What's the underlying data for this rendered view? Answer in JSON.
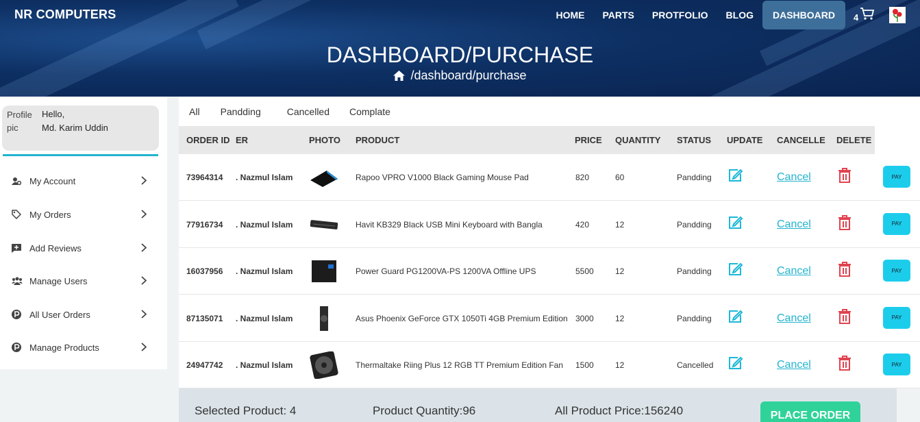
{
  "brand": "NR COMPUTERS",
  "nav": {
    "items": [
      "HOME",
      "PARTS",
      "PROTFOLIO",
      "BLOG",
      "DASHBOARD"
    ],
    "cart_count": "4"
  },
  "hero": {
    "title": "DASHBOARD/PURCHASE",
    "breadcrumb": "/dashboard/purchase"
  },
  "profile": {
    "pic_alt": "Profile pic",
    "greeting": "Hello,",
    "name": "Md. Karim Uddin"
  },
  "sidebar": {
    "items": [
      {
        "label": "My Account",
        "icon": "user-gear-icon"
      },
      {
        "label": "My Orders",
        "icon": "tag-icon"
      },
      {
        "label": "Add Reviews",
        "icon": "review-icon"
      },
      {
        "label": "Manage Users",
        "icon": "users-icon"
      },
      {
        "label": "All User Orders",
        "icon": "p-circle-icon"
      },
      {
        "label": "Manage Products",
        "icon": "p-circle-icon"
      }
    ]
  },
  "filters": [
    "All",
    "Pandding",
    "Cancelled",
    "Complate"
  ],
  "table": {
    "headers": [
      "ORDER ID",
      "ER",
      "PHOTO",
      "PRODUCT",
      "PRICE",
      "QUANTITY",
      "STATUS",
      "UPDATE",
      "CANCELLE",
      "DELETE"
    ],
    "cancel_label": "Cancel",
    "pay_label": "PAY",
    "rows": [
      {
        "order_id": "73964314",
        "customer": ". Nazmul Islam",
        "product": "Rapoo VPRO V1000 Black Gaming Mouse Pad",
        "price": "820",
        "quantity": "60",
        "status": "Pandding",
        "photo": "mousepad"
      },
      {
        "order_id": "77916734",
        "customer": ". Nazmul Islam",
        "product": "Havit KB329 Black USB Mini Keyboard with Bangla",
        "price": "420",
        "quantity": "12",
        "status": "Pandding",
        "photo": "keyboard"
      },
      {
        "order_id": "16037956",
        "customer": ". Nazmul Islam",
        "product": "Power Guard PG1200VA-PS 1200VA Offline UPS",
        "price": "5500",
        "quantity": "12",
        "status": "Pandding",
        "photo": "ups"
      },
      {
        "order_id": "87135071",
        "customer": ". Nazmul Islam",
        "product": "Asus Phoenix GeForce GTX 1050Ti 4GB Premium Edition",
        "price": "3000",
        "quantity": "12",
        "status": "Pandding",
        "photo": "gpu"
      },
      {
        "order_id": "24947742",
        "customer": ". Nazmul Islam",
        "product": "Thermaltake Riing Plus 12 RGB TT Premium Edition Fan",
        "price": "1500",
        "quantity": "12",
        "status": "Cancelled",
        "photo": "fan"
      }
    ]
  },
  "summary": {
    "selected": "Selected Product: 4",
    "quantity": "Product Quantity:96",
    "price": "All Product Price:156240",
    "place_order": "PLACE ORDER"
  },
  "colors": {
    "accent": "#22b4cf",
    "pay": "#1ccdeb",
    "delete": "#e0434f",
    "place_order": "#2fd39a",
    "nav_active": "#3e6f9b"
  }
}
